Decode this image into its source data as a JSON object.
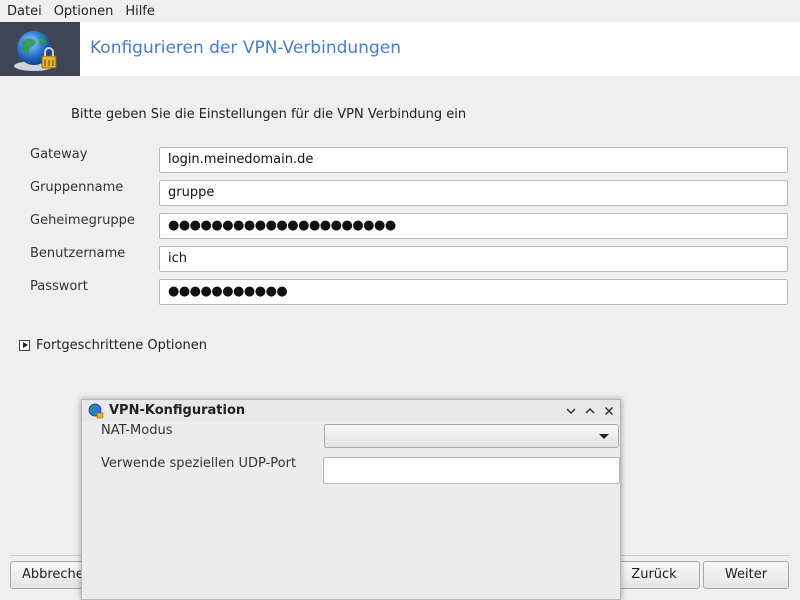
{
  "menubar": {
    "items": [
      "Datei",
      "Optionen",
      "Hilfe"
    ]
  },
  "banner": {
    "title": "Konfigurieren der VPN-Verbindungen",
    "icon": "globe-lock-icon"
  },
  "intro": "Bitte geben Sie die Einstellungen für die VPN Verbindung ein",
  "form": {
    "fields": [
      {
        "label": "Gateway",
        "value": "login.meinedomain.de"
      },
      {
        "label": "Gruppenname",
        "value": "gruppe"
      },
      {
        "label": "Geheimegruppe",
        "value": "●●●●●●●●●●●●●●●●●●●●●"
      },
      {
        "label": "Benutzername",
        "value": "ich"
      },
      {
        "label": "Passwort",
        "value": "●●●●●●●●●●●"
      }
    ]
  },
  "advanced": {
    "label": "Fortgeschrittene Optionen"
  },
  "buttons": {
    "cancel": "Abbrechen",
    "back": "Zurück",
    "next": "Weiter"
  },
  "dialog": {
    "title": "VPN-Konfiguration",
    "nat_label": "NAT-Modus",
    "nat_value": "",
    "udp_label": "Verwende speziellen UDP-Port",
    "udp_value": ""
  },
  "colors": {
    "accent": "#4a7ec3",
    "banner_icon_bg": "#3e4555"
  }
}
